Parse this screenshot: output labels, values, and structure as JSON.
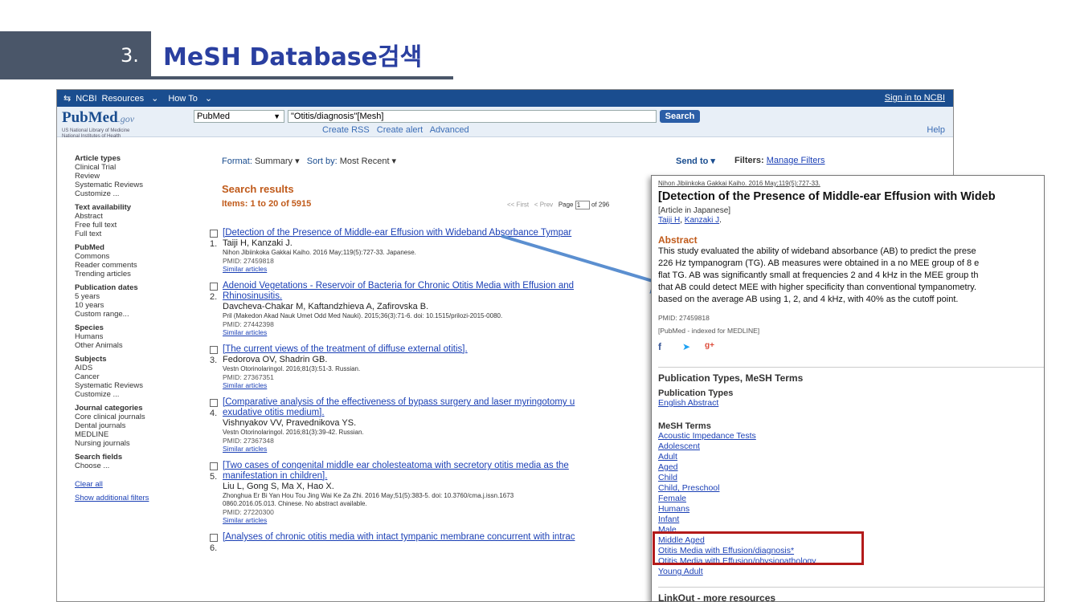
{
  "slide": {
    "number": "3.",
    "title": "MeSH Database검색"
  },
  "topbar": {
    "ncbi": "NCBI",
    "resources": "Resources",
    "howto": "How To",
    "signin": "Sign in to NCBI"
  },
  "search": {
    "logo": "PubMed",
    "logo_gov": ".gov",
    "logo_sub1": "US National Library of Medicine",
    "logo_sub2": "National Institutes of Health",
    "database": "PubMed",
    "query": "\"Otitis/diagnosis\"[Mesh]",
    "button": "Search",
    "links": [
      "Create RSS",
      "Create alert",
      "Advanced"
    ],
    "help": "Help"
  },
  "sidebar": {
    "groups": [
      {
        "heading": "Article types",
        "items": [
          "Clinical Trial",
          "Review",
          "Systematic Reviews",
          "Customize ..."
        ]
      },
      {
        "heading": "Text availability",
        "items": [
          "Abstract",
          "Free full text",
          "Full text"
        ]
      },
      {
        "heading": "PubMed",
        "items": [
          "Commons",
          "Reader comments",
          "Trending articles"
        ]
      },
      {
        "heading": "Publication dates",
        "items": [
          "5 years",
          "10 years",
          "Custom range..."
        ]
      },
      {
        "heading": "Species",
        "items": [
          "Humans",
          "Other Animals"
        ]
      },
      {
        "heading": "Subjects",
        "items": [
          "AIDS",
          "Cancer",
          "Systematic Reviews",
          "Customize ..."
        ]
      },
      {
        "heading": "Journal categories",
        "items": [
          "Core clinical journals",
          "Dental journals",
          "MEDLINE",
          "Nursing journals"
        ]
      },
      {
        "heading": "Search fields",
        "items": [
          "Choose ..."
        ]
      }
    ],
    "clear_all": "Clear all",
    "show_additional": "Show additional filters"
  },
  "toolbar": {
    "format_label": "Format:",
    "format_value": "Summary",
    "sort_label": "Sort by:",
    "sort_value": "Most Recent",
    "send_to": "Send to",
    "filters_label": "Filters:",
    "manage_filters": "Manage Filters"
  },
  "results_header": {
    "title": "Search results",
    "items": "Items: 1 to 20 of 5915",
    "first": "<< First",
    "prev": "< Prev",
    "page_label": "Page",
    "page": "1",
    "of_pages": "of 296"
  },
  "results": [
    {
      "num": "1.",
      "title": "[Detection of the Presence of Middle-ear Effusion with Wideband Absorbance Tympar",
      "title2": "",
      "authors": "Taiji H, Kanzaki J.",
      "journal": "Nihon Jibiinkoka Gakkai Kaiho. 2016 May;119(5):727-33. Japanese.",
      "journal2": "",
      "pmid": "PMID: 27459818",
      "similar": "Similar articles"
    },
    {
      "num": "2.",
      "title": "Adenoid Vegetations - Reservoir of Bacteria for Chronic Otitis Media with Effusion and",
      "title2": "Rhinosinusitis.",
      "authors": "Davcheva-Chakar M, Kaftandzhieva A, Zafirovska B.",
      "journal": "Pril (Makedon Akad Nauk Umet Odd Med Nauki). 2015;36(3):71-6. doi: 10.1515/prilozi-2015-0080.",
      "journal2": "",
      "pmid": "PMID: 27442398",
      "similar": "Similar articles"
    },
    {
      "num": "3.",
      "title": "[The current views of the treatment of diffuse external otitis].",
      "title2": "",
      "authors": "Fedorova OV, Shadrin GB.",
      "journal": "Vestn Otorinolaringol. 2016;81(3):51-3. Russian.",
      "journal2": "",
      "pmid": "PMID: 27367351",
      "similar": "Similar articles"
    },
    {
      "num": "4.",
      "title": "[Comparative analysis of the effectiveness of bypass surgery and laser myringotomy u",
      "title2": "exudative otitis medium].",
      "authors": "Vishnyakov VV, Pravednikova YS.",
      "journal": "Vestn Otorinolaringol. 2016;81(3):39-42. Russian.",
      "journal2": "",
      "pmid": "PMID: 27367348",
      "similar": "Similar articles"
    },
    {
      "num": "5.",
      "title": "[Two cases of congenital middle ear cholesteatoma with secretory otitis media as the",
      "title2": "manifestation in children].",
      "authors": "Liu L, Gong S, Ma X, Hao X.",
      "journal": "Zhonghua Er Bi Yan Hou Tou Jing Wai Ke Za Zhi. 2016 May;51(5):383-5. doi: 10.3760/cma.j.issn.1673",
      "journal2": "0860.2016.05.013. Chinese. No abstract available.",
      "pmid": "PMID: 27220300",
      "similar": "Similar articles"
    },
    {
      "num": "6.",
      "title": "[Analyses of chronic otitis media with intact tympanic membrane concurrent with intrac",
      "title2": "",
      "authors": "",
      "journal": "",
      "journal2": "",
      "pmid": "",
      "similar": ""
    }
  ],
  "popup": {
    "citation": "Nihon Jibiinkoka Gakkai Kaiho. 2016 May;119(5):727-33.",
    "title": "[Detection of the Presence of Middle-ear Effusion with Wideb",
    "lang": "[Article in Japanese]",
    "author1": "Taiji H",
    "author2": "Kanzaki J",
    "abstract_heading": "Abstract",
    "abstract_lines": [
      "This study evaluated the ability of wideband absorbance (AB) to predict the prese",
      "226 Hz tympanogram (TG). AB measures were obtained in a no MEE group of 8 e",
      "flat TG. AB was significantly small at frequencies 2 and 4 kHz in the MEE group th",
      "that AB could detect MEE with higher specificity than conventional tympanometry.",
      "based on the average AB using 1, 2, and 4 kHz, with 40% as the cutoff point."
    ],
    "pmid": "PMID: 27459818",
    "indexed": "[PubMed - indexed for MEDLINE]",
    "pub_types_heading": "Publication Types, MeSH Terms",
    "pub_types_sub": "Publication Types",
    "pub_type": "English Abstract",
    "mesh_sub": "MeSH Terms",
    "mesh_terms": [
      "Acoustic Impedance Tests",
      "Adolescent",
      "Adult",
      "Aged",
      "Child",
      "Child, Preschool",
      "Female",
      "Humans",
      "Infant",
      "Male",
      "Middle Aged",
      "Otitis Media with Effusion/diagnosis*",
      "Otitis Media with Effusion/physiopathology",
      "Young Adult"
    ],
    "linkout": "LinkOut - more resources"
  },
  "colors": {
    "ncbi_bar": "#1a4d8f",
    "accent_orange": "#c05a1a",
    "highlight_red": "#b31a1a",
    "arrow_blue": "#5b8fd0"
  }
}
